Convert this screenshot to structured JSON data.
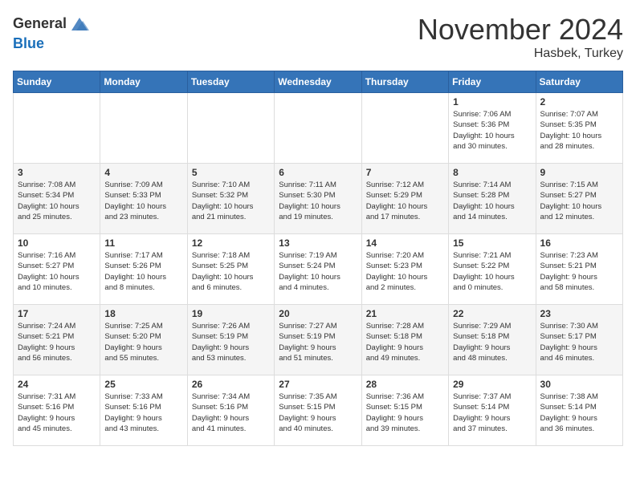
{
  "header": {
    "logo_line1": "General",
    "logo_line2": "Blue",
    "month": "November 2024",
    "location": "Hasbek, Turkey"
  },
  "weekdays": [
    "Sunday",
    "Monday",
    "Tuesday",
    "Wednesday",
    "Thursday",
    "Friday",
    "Saturday"
  ],
  "weeks": [
    [
      {
        "day": "",
        "info": ""
      },
      {
        "day": "",
        "info": ""
      },
      {
        "day": "",
        "info": ""
      },
      {
        "day": "",
        "info": ""
      },
      {
        "day": "",
        "info": ""
      },
      {
        "day": "1",
        "info": "Sunrise: 7:06 AM\nSunset: 5:36 PM\nDaylight: 10 hours\nand 30 minutes."
      },
      {
        "day": "2",
        "info": "Sunrise: 7:07 AM\nSunset: 5:35 PM\nDaylight: 10 hours\nand 28 minutes."
      }
    ],
    [
      {
        "day": "3",
        "info": "Sunrise: 7:08 AM\nSunset: 5:34 PM\nDaylight: 10 hours\nand 25 minutes."
      },
      {
        "day": "4",
        "info": "Sunrise: 7:09 AM\nSunset: 5:33 PM\nDaylight: 10 hours\nand 23 minutes."
      },
      {
        "day": "5",
        "info": "Sunrise: 7:10 AM\nSunset: 5:32 PM\nDaylight: 10 hours\nand 21 minutes."
      },
      {
        "day": "6",
        "info": "Sunrise: 7:11 AM\nSunset: 5:30 PM\nDaylight: 10 hours\nand 19 minutes."
      },
      {
        "day": "7",
        "info": "Sunrise: 7:12 AM\nSunset: 5:29 PM\nDaylight: 10 hours\nand 17 minutes."
      },
      {
        "day": "8",
        "info": "Sunrise: 7:14 AM\nSunset: 5:28 PM\nDaylight: 10 hours\nand 14 minutes."
      },
      {
        "day": "9",
        "info": "Sunrise: 7:15 AM\nSunset: 5:27 PM\nDaylight: 10 hours\nand 12 minutes."
      }
    ],
    [
      {
        "day": "10",
        "info": "Sunrise: 7:16 AM\nSunset: 5:27 PM\nDaylight: 10 hours\nand 10 minutes."
      },
      {
        "day": "11",
        "info": "Sunrise: 7:17 AM\nSunset: 5:26 PM\nDaylight: 10 hours\nand 8 minutes."
      },
      {
        "day": "12",
        "info": "Sunrise: 7:18 AM\nSunset: 5:25 PM\nDaylight: 10 hours\nand 6 minutes."
      },
      {
        "day": "13",
        "info": "Sunrise: 7:19 AM\nSunset: 5:24 PM\nDaylight: 10 hours\nand 4 minutes."
      },
      {
        "day": "14",
        "info": "Sunrise: 7:20 AM\nSunset: 5:23 PM\nDaylight: 10 hours\nand 2 minutes."
      },
      {
        "day": "15",
        "info": "Sunrise: 7:21 AM\nSunset: 5:22 PM\nDaylight: 10 hours\nand 0 minutes."
      },
      {
        "day": "16",
        "info": "Sunrise: 7:23 AM\nSunset: 5:21 PM\nDaylight: 9 hours\nand 58 minutes."
      }
    ],
    [
      {
        "day": "17",
        "info": "Sunrise: 7:24 AM\nSunset: 5:21 PM\nDaylight: 9 hours\nand 56 minutes."
      },
      {
        "day": "18",
        "info": "Sunrise: 7:25 AM\nSunset: 5:20 PM\nDaylight: 9 hours\nand 55 minutes."
      },
      {
        "day": "19",
        "info": "Sunrise: 7:26 AM\nSunset: 5:19 PM\nDaylight: 9 hours\nand 53 minutes."
      },
      {
        "day": "20",
        "info": "Sunrise: 7:27 AM\nSunset: 5:19 PM\nDaylight: 9 hours\nand 51 minutes."
      },
      {
        "day": "21",
        "info": "Sunrise: 7:28 AM\nSunset: 5:18 PM\nDaylight: 9 hours\nand 49 minutes."
      },
      {
        "day": "22",
        "info": "Sunrise: 7:29 AM\nSunset: 5:18 PM\nDaylight: 9 hours\nand 48 minutes."
      },
      {
        "day": "23",
        "info": "Sunrise: 7:30 AM\nSunset: 5:17 PM\nDaylight: 9 hours\nand 46 minutes."
      }
    ],
    [
      {
        "day": "24",
        "info": "Sunrise: 7:31 AM\nSunset: 5:16 PM\nDaylight: 9 hours\nand 45 minutes."
      },
      {
        "day": "25",
        "info": "Sunrise: 7:33 AM\nSunset: 5:16 PM\nDaylight: 9 hours\nand 43 minutes."
      },
      {
        "day": "26",
        "info": "Sunrise: 7:34 AM\nSunset: 5:16 PM\nDaylight: 9 hours\nand 41 minutes."
      },
      {
        "day": "27",
        "info": "Sunrise: 7:35 AM\nSunset: 5:15 PM\nDaylight: 9 hours\nand 40 minutes."
      },
      {
        "day": "28",
        "info": "Sunrise: 7:36 AM\nSunset: 5:15 PM\nDaylight: 9 hours\nand 39 minutes."
      },
      {
        "day": "29",
        "info": "Sunrise: 7:37 AM\nSunset: 5:14 PM\nDaylight: 9 hours\nand 37 minutes."
      },
      {
        "day": "30",
        "info": "Sunrise: 7:38 AM\nSunset: 5:14 PM\nDaylight: 9 hours\nand 36 minutes."
      }
    ]
  ]
}
